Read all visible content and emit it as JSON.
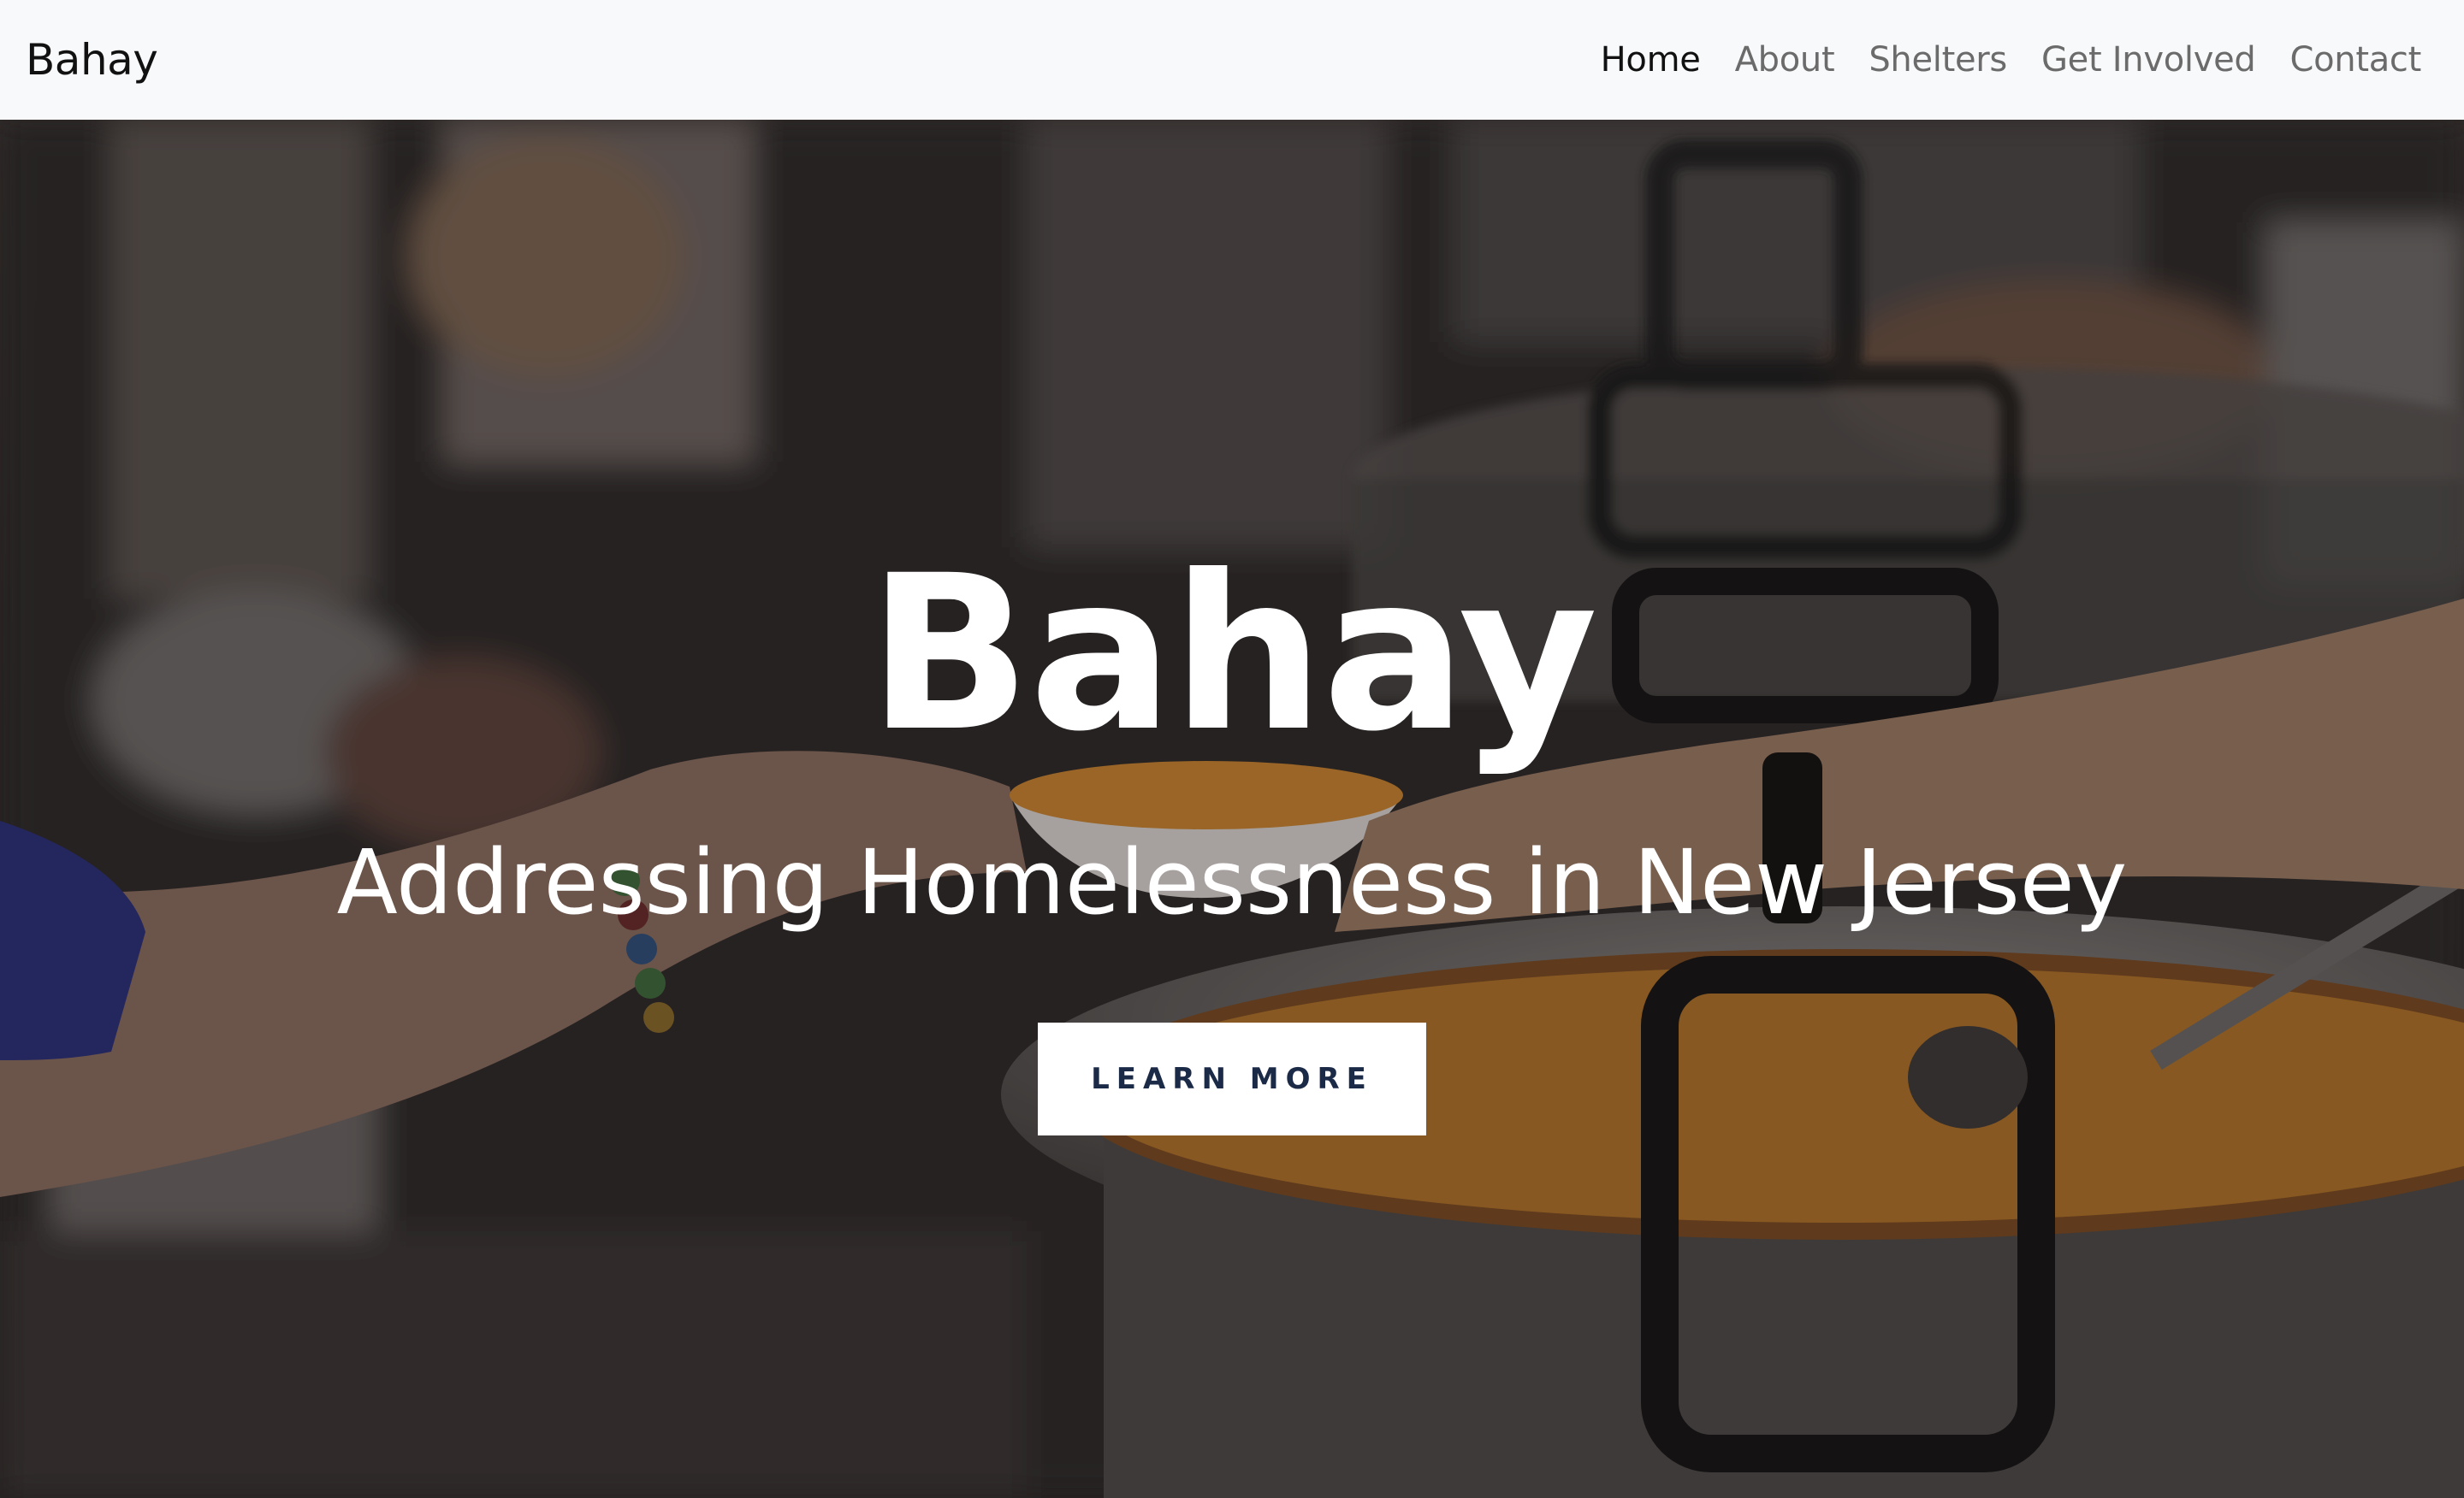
{
  "nav": {
    "brand": "Bahay",
    "links": [
      {
        "label": "Home",
        "active": true
      },
      {
        "label": "About",
        "active": false
      },
      {
        "label": "Shelters",
        "active": false
      },
      {
        "label": "Get Involved",
        "active": false
      },
      {
        "label": "Contact",
        "active": false
      }
    ]
  },
  "hero": {
    "title": "Bahay",
    "subtitle": "Addressing Homelessness in New Jersey",
    "cta_label": "LEARN MORE",
    "background": "photo of volunteers serving food from large cooking pots"
  },
  "colors": {
    "navbar_bg": "#f8f9fa",
    "cta_text": "#1b2a47",
    "hero_text": "#ffffff"
  }
}
